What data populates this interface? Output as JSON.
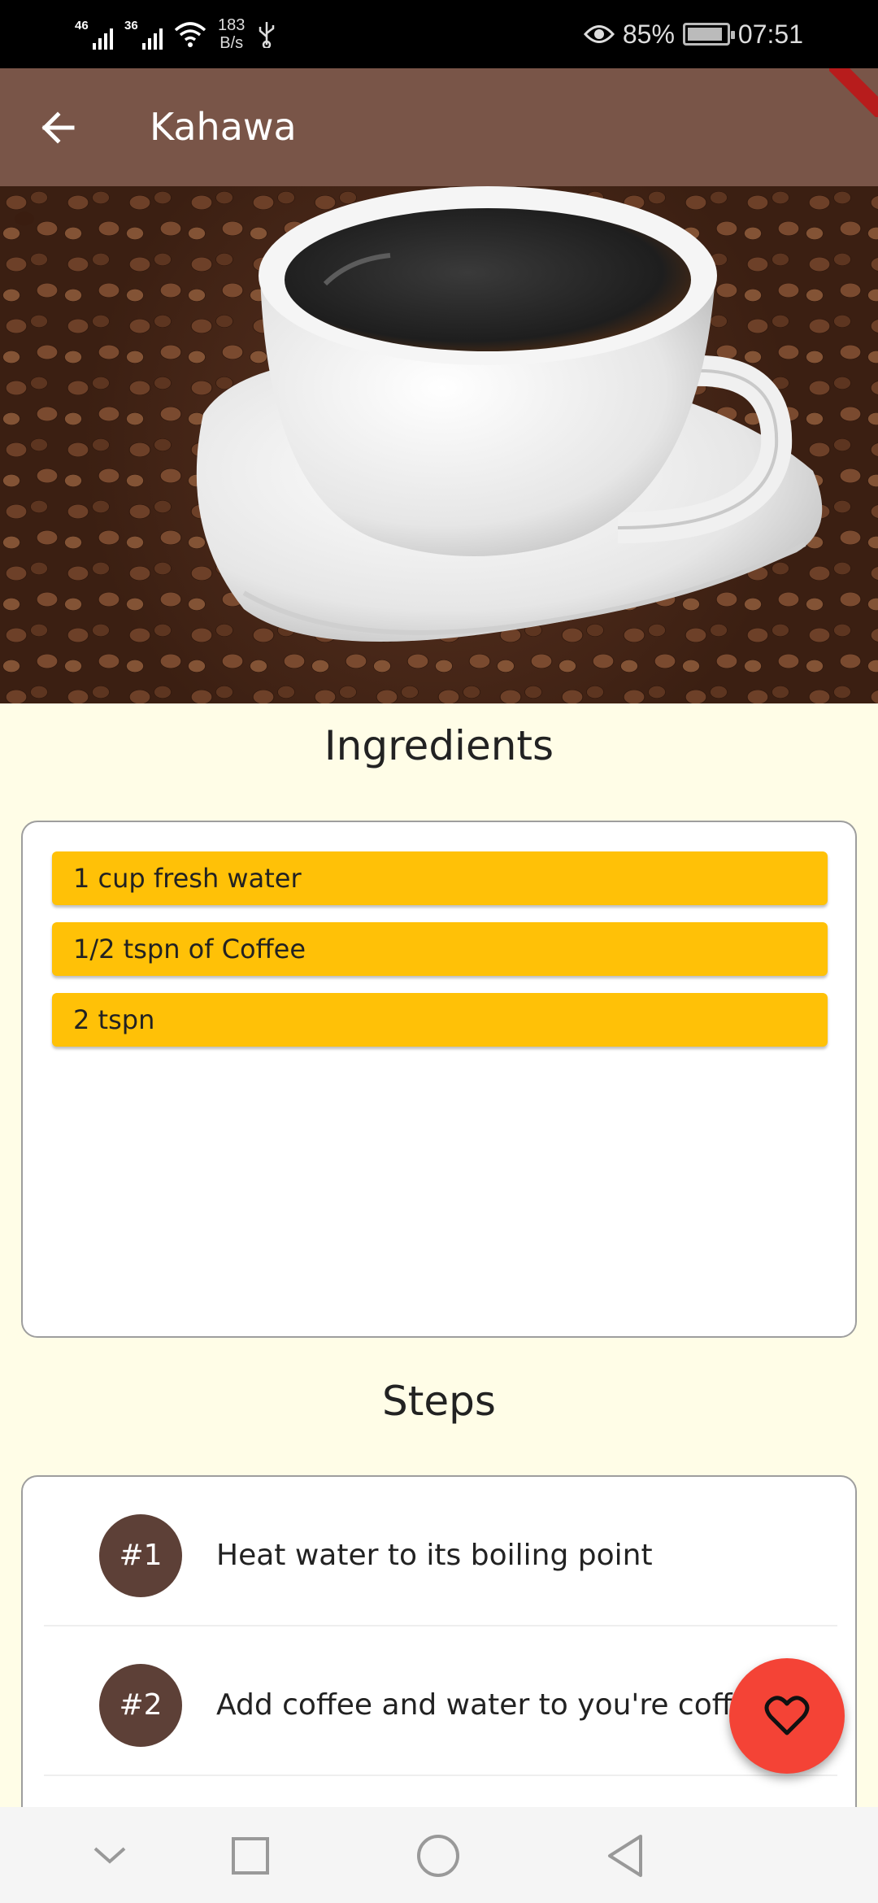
{
  "status_bar": {
    "signal_1": "46",
    "signal_2": "36",
    "net_speed_value": "183",
    "net_speed_unit": "B/s",
    "battery": "85%",
    "time": "07:51",
    "icons": [
      "signal-icon",
      "wifi-icon",
      "usb-icon",
      "eye-icon",
      "battery-icon"
    ]
  },
  "app_bar": {
    "title": "Kahawa",
    "back_icon": "arrow-left-icon",
    "color": "#795548"
  },
  "hero": {
    "description_icon": "coffee-cup-image"
  },
  "ingredients": {
    "title": "Ingredients",
    "items": [
      "1 cup fresh water",
      "1/2 tspn of Coffee",
      "2 tspn"
    ],
    "item_color": "#ffc107"
  },
  "steps": {
    "title": "Steps",
    "items": [
      {
        "badge": "#1",
        "text": "Heat water to its boiling point"
      },
      {
        "badge": "#2",
        "text": "Add coffee and water to you're coffee cup"
      }
    ],
    "badge_color": "#5d4037"
  },
  "fab": {
    "icon": "heart-outline-icon",
    "color": "#f44336"
  },
  "nav_bar": {
    "icons": [
      "chevron-down-icon",
      "recents-square-icon",
      "home-circle-icon",
      "back-triangle-icon"
    ]
  }
}
